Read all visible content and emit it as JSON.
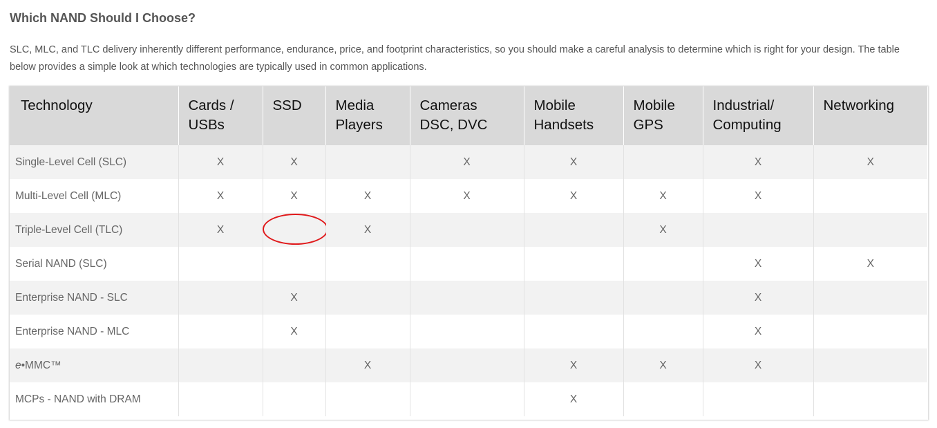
{
  "page": {
    "title": "Which NAND Should I Choose?",
    "intro": "SLC, MLC, and TLC delivery inherently different performance, endurance, price, and footprint characteristics, so you should make a careful analysis to determine which is right for your design. The table below provides a simple look at which technologies are typically used in common applications."
  },
  "table": {
    "headers": [
      {
        "line1": "Technology",
        "line2": ""
      },
      {
        "line1": "Cards /",
        "line2": "USBs"
      },
      {
        "line1": "SSD",
        "line2": ""
      },
      {
        "line1": "Media",
        "line2": "Players"
      },
      {
        "line1": "Cameras",
        "line2": "DSC, DVC"
      },
      {
        "line1": "Mobile",
        "line2": "Handsets"
      },
      {
        "line1": "Mobile",
        "line2": "GPS"
      },
      {
        "line1": "Industrial/",
        "line2": "Computing"
      },
      {
        "line1": "Networking",
        "line2": ""
      }
    ],
    "rows": [
      {
        "label": "Single-Level Cell (SLC)",
        "cells": [
          "X",
          "X",
          "",
          "X",
          "X",
          "",
          "X",
          "X"
        ]
      },
      {
        "label": "Multi-Level Cell (MLC)",
        "cells": [
          "X",
          "X",
          "X",
          "X",
          "X",
          "X",
          "X",
          ""
        ]
      },
      {
        "label": "Triple-Level Cell (TLC)",
        "cells": [
          "X",
          "",
          "X",
          "",
          "",
          "X",
          "",
          ""
        ]
      },
      {
        "label": "Serial NAND (SLC)",
        "cells": [
          "",
          "",
          "",
          "",
          "",
          "",
          "X",
          "X"
        ]
      },
      {
        "label": "Enterprise NAND - SLC",
        "cells": [
          "",
          "X",
          "",
          "",
          "",
          "",
          "X",
          ""
        ]
      },
      {
        "label": "Enterprise NAND - MLC",
        "cells": [
          "",
          "X",
          "",
          "",
          "",
          "",
          "X",
          ""
        ]
      },
      {
        "label_prefix": "e",
        "label": "•MMC™",
        "cells": [
          "",
          "",
          "X",
          "",
          "X",
          "X",
          "X",
          ""
        ]
      },
      {
        "label": "MCPs - NAND with DRAM",
        "cells": [
          "",
          "",
          "",
          "",
          "X",
          "",
          "",
          ""
        ]
      }
    ]
  },
  "annotation": {
    "shape": "ellipse",
    "color": "#e0191b",
    "target": "Triple-Level Cell (TLC) / SSD"
  },
  "colors": {
    "header_bg": "#d9d9d9",
    "row_alt_bg": "#f2f2f2",
    "text": "#555555"
  }
}
